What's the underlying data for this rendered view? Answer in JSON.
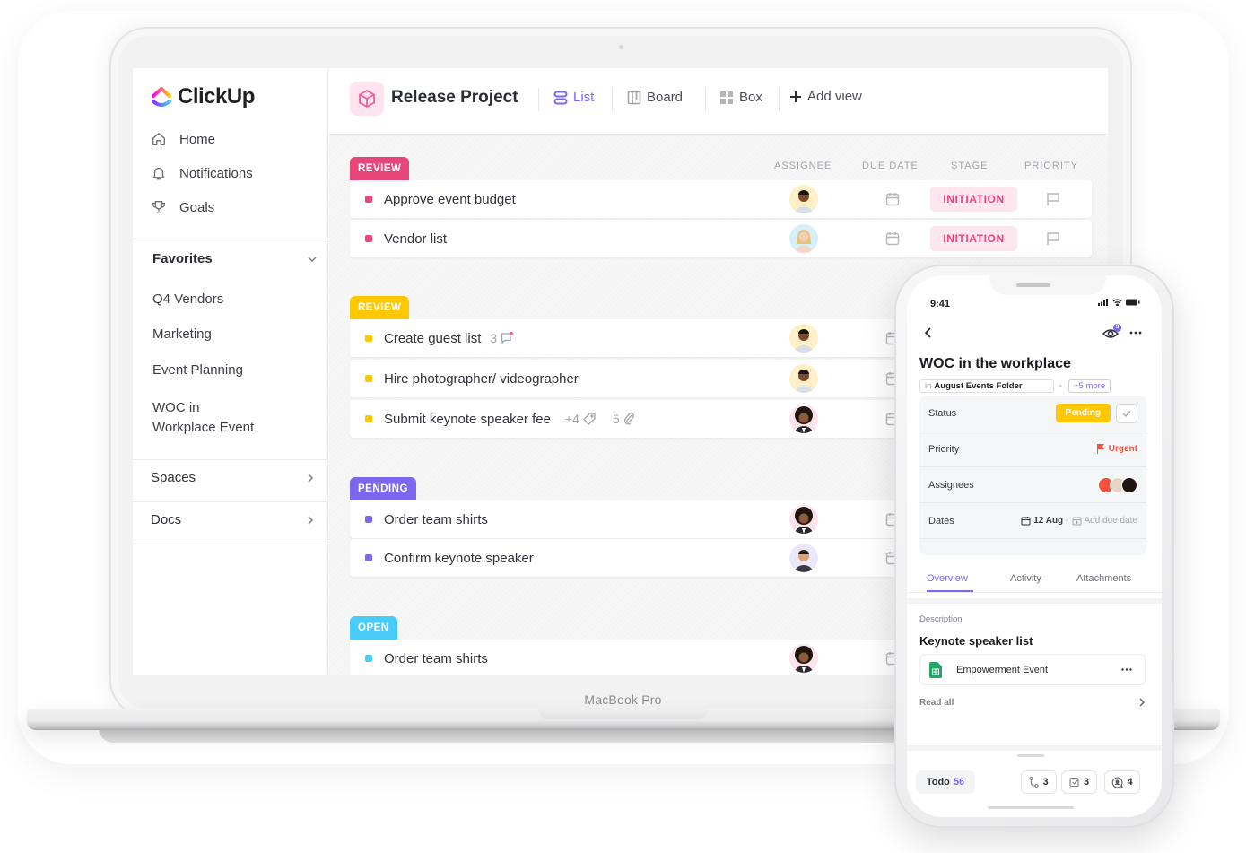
{
  "device": {
    "laptop_label": "MacBook Pro"
  },
  "sidebar": {
    "brand": "ClickUp",
    "nav": [
      {
        "label": "Home",
        "icon": "home-icon"
      },
      {
        "label": "Notifications",
        "icon": "bell-icon"
      },
      {
        "label": "Goals",
        "icon": "trophy-icon"
      }
    ],
    "favorites": {
      "title": "Favorites",
      "items": [
        "Q4 Vendors",
        "Marketing",
        "Event Planning",
        "WOC in",
        "Workplace Event"
      ]
    },
    "sections": [
      {
        "label": "Spaces"
      },
      {
        "label": "Docs"
      }
    ]
  },
  "header": {
    "project_title": "Release Project",
    "views": [
      {
        "label": "List",
        "active": true
      },
      {
        "label": "Board"
      },
      {
        "label": "Box"
      },
      {
        "label": "Add view"
      }
    ]
  },
  "columns": {
    "assignee": "ASSIGNEE",
    "due_date": "DUE DATE",
    "stage": "STAGE",
    "priority": "PRIORITY"
  },
  "groups": [
    {
      "label": "REVIEW",
      "color": "#e8457b",
      "tasks": [
        {
          "name": "Approve event budget",
          "stage": "INITIATION"
        },
        {
          "name": "Vendor list",
          "stage": "INITIATION"
        }
      ]
    },
    {
      "label": "REVIEW",
      "color": "#ffc800",
      "tasks": [
        {
          "name": "Create guest list",
          "comments": "3"
        },
        {
          "name": "Hire photographer/ videographer"
        },
        {
          "name": "Submit keynote speaker fee",
          "tags": "+4",
          "attachments": "5"
        }
      ]
    },
    {
      "label": "PENDING",
      "color": "#7b68ee",
      "tasks": [
        {
          "name": "Order team shirts"
        },
        {
          "name": "Confirm keynote speaker"
        }
      ]
    },
    {
      "label": "OPEN",
      "color": "#49ccf9",
      "tasks": [
        {
          "name": "Order team shirts"
        }
      ]
    }
  ],
  "phone": {
    "time": "9:41",
    "watchers_badge": "3",
    "task_title": "WOC in the workplace",
    "folder_prefix": "in",
    "folder": "August Events Folder",
    "more": "+5 more",
    "props": {
      "status_label": "Status",
      "status_value": "Pending",
      "priority_label": "Priority",
      "priority_value": "Urgent",
      "assignees_label": "Assignees",
      "dates_label": "Dates",
      "start_date": "12 Aug",
      "due_placeholder": "Add due date"
    },
    "tabs": [
      "Overview",
      "Activity",
      "Attachments"
    ],
    "description_label": "Description",
    "description_title": "Keynote speaker list",
    "doc_name": "Empowerment Event",
    "read_all": "Read all",
    "todo_label": "Todo",
    "todo_count": "56",
    "subtasks": "3",
    "checklists": "3",
    "comments": "4"
  }
}
